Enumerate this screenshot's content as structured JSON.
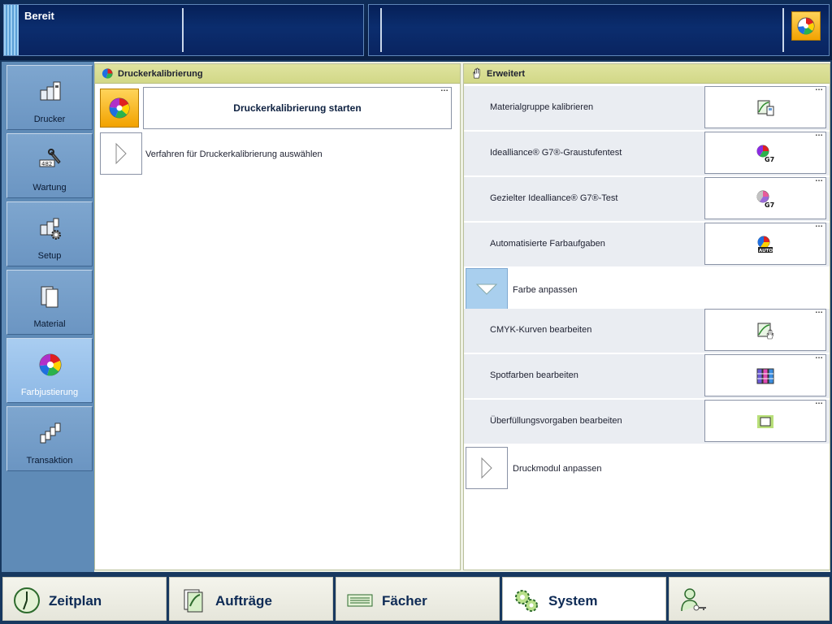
{
  "status": {
    "text": "Bereit"
  },
  "sidebar": {
    "items": [
      {
        "label": "Drucker",
        "icon": "printer-icon"
      },
      {
        "label": "Wartung",
        "icon": "wrench-icon"
      },
      {
        "label": "Setup",
        "icon": "setup-gear-icon"
      },
      {
        "label": "Material",
        "icon": "media-sheets-icon"
      },
      {
        "label": "Farbjustierung",
        "icon": "color-wheel-icon",
        "active": true
      },
      {
        "label": "Transaktion",
        "icon": "transaction-icon"
      }
    ]
  },
  "left_panel": {
    "title": "Druckerkalibrierung",
    "start_button": "Druckerkalibrierung starten",
    "procedure_label": "Verfahren für Druckerkalibrierung auswählen"
  },
  "right_panel": {
    "title": "Erweitert",
    "rows": [
      {
        "label": "Materialgruppe kalibrieren",
        "icon": "media-calibrate-icon"
      },
      {
        "label": "Idealliance® G7®-Graustufentest",
        "icon": "g7-gray-icon"
      },
      {
        "label": "Gezielter Idealliance® G7®-Test",
        "icon": "g7-test-icon"
      },
      {
        "label": "Automatisierte Farbaufgaben",
        "icon": "auto-color-icon"
      }
    ],
    "section_color": "Farbe anpassen",
    "color_rows": [
      {
        "label": "CMYK-Kurven bearbeiten",
        "icon": "cmyk-curves-icon"
      },
      {
        "label": "Spotfarben bearbeiten",
        "icon": "spot-colors-icon"
      },
      {
        "label": "Überfüllungsvorgaben bearbeiten",
        "icon": "trapping-icon"
      }
    ],
    "section_module": "Druckmodul anpassen"
  },
  "bottom_nav": {
    "tabs": [
      {
        "label": "Zeitplan",
        "icon": "clock-icon"
      },
      {
        "label": "Aufträge",
        "icon": "jobs-icon"
      },
      {
        "label": "Fächer",
        "icon": "trays-icon"
      },
      {
        "label": "System",
        "icon": "system-gears-icon",
        "active": true
      }
    ],
    "user_icon": "user-key-icon"
  },
  "colors": {
    "accent": "#f2a200",
    "panel_header": "#d2d887",
    "active_side": "#8db8e5",
    "topbar": "#0a2460"
  }
}
